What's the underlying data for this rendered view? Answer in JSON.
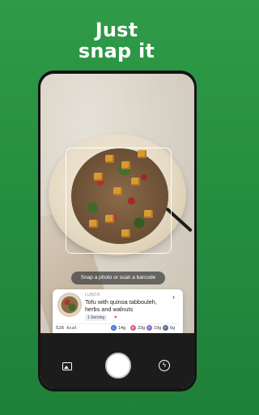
{
  "headline": {
    "line1": "Just",
    "line2": "snap it"
  },
  "camera": {
    "hint": "Snap a photo or scan a barcode"
  },
  "meal_card": {
    "meal_type": "LUNCH",
    "name": "Tofu with quinoa tabbouleh, herbs and walnuts",
    "serving": "1 Serving",
    "kcal": "528 kcal",
    "macros": [
      {
        "letter": "C",
        "value": "14g",
        "color": "#3d6fe0"
      },
      {
        "letter": "P",
        "value": "23g",
        "color": "#e05b8a"
      },
      {
        "letter": "F",
        "value": "19g",
        "color": "#8f63d9"
      },
      {
        "letter": "F",
        "value": "6g",
        "color": "#5b6b8a"
      }
    ]
  },
  "toolbar": {
    "gallery": "gallery-icon",
    "shutter": "shutter-button",
    "flash": "flash-icon"
  }
}
